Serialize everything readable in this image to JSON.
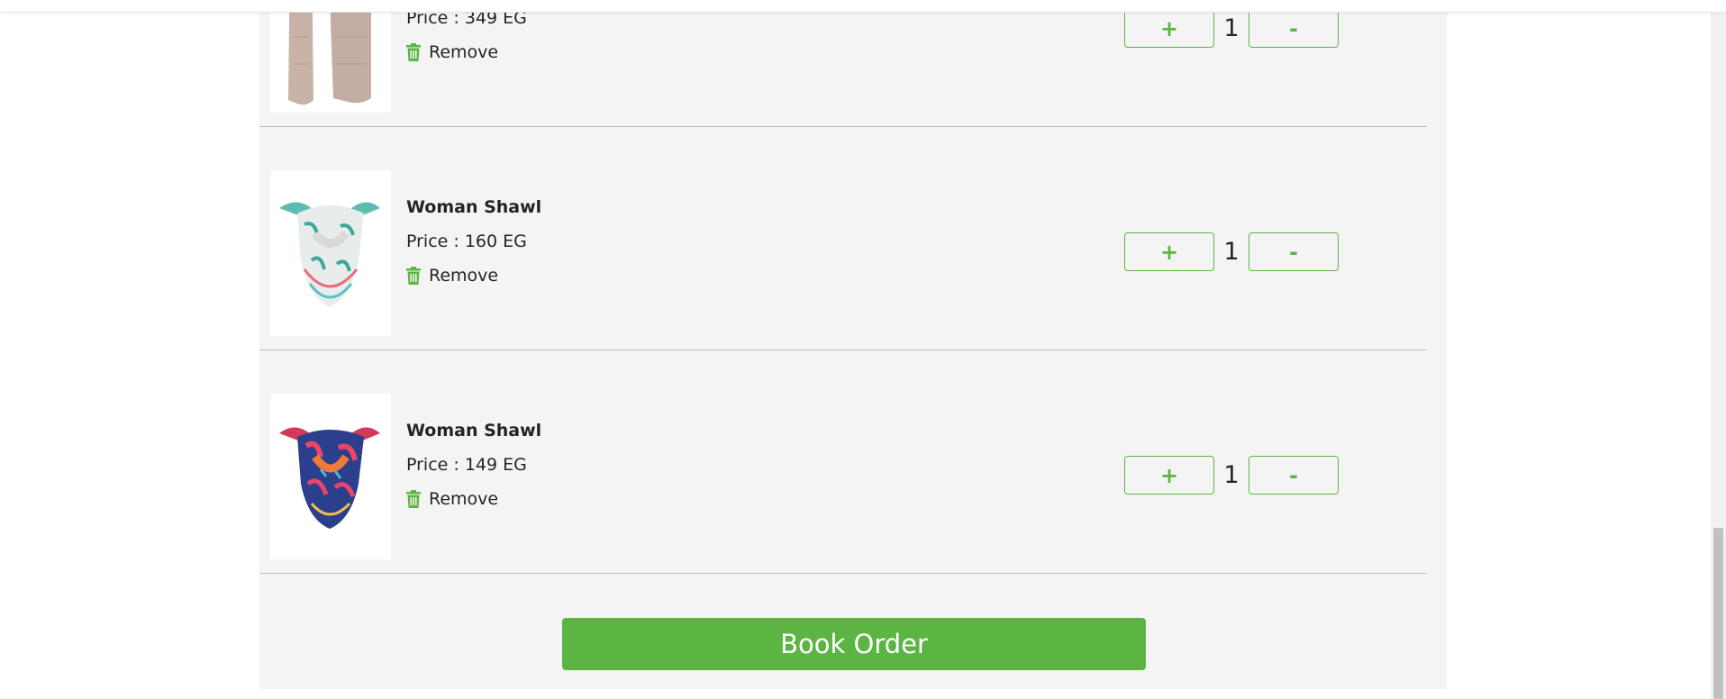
{
  "cart": {
    "items": [
      {
        "name": "",
        "price_text": "Price : 349 EG",
        "remove_label": "Remove",
        "plus_label": "+",
        "quantity": "1",
        "minus_label": "-",
        "image": "beige knit scarf",
        "icon": "trash-icon"
      },
      {
        "name": "Woman Shawl",
        "price_text": "Price : 160 EG",
        "remove_label": "Remove",
        "plus_label": "+",
        "quantity": "1",
        "minus_label": "-",
        "image": "white patterned neck scarf",
        "icon": "trash-icon"
      },
      {
        "name": "Woman Shawl",
        "price_text": "Price : 149 EG",
        "remove_label": "Remove",
        "plus_label": "+",
        "quantity": "1",
        "minus_label": "-",
        "image": "navy and red patterned neck scarf",
        "icon": "trash-icon"
      }
    ],
    "book_order_label": "Book Order"
  },
  "colors": {
    "accent": "#5cb543",
    "panel_bg": "#f4f4f4",
    "divider": "#bdbdbd"
  }
}
